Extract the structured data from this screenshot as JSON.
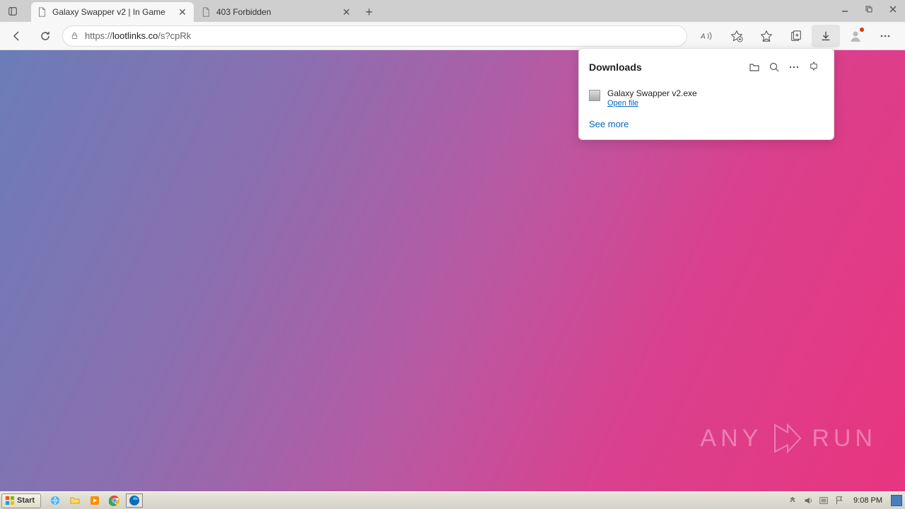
{
  "tabs": [
    {
      "title": "Galaxy Swapper v2 | In Game"
    },
    {
      "title": "403 Forbidden"
    }
  ],
  "url_prefix": "https://",
  "url_domain": "lootlinks.co",
  "url_path": "/s?cpRk",
  "downloads": {
    "title": "Downloads",
    "item_name": "Galaxy Swapper v2.exe",
    "open_label": "Open file",
    "see_more": "See more"
  },
  "watermark": {
    "text": "ANY",
    "text2": "RUN"
  },
  "taskbar": {
    "start": "Start",
    "clock": "9:08 PM"
  }
}
